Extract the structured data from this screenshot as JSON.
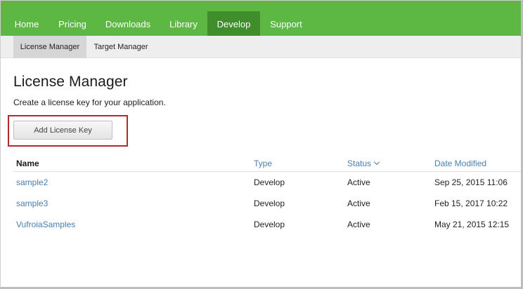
{
  "topnav": {
    "items": [
      {
        "label": "Home"
      },
      {
        "label": "Pricing"
      },
      {
        "label": "Downloads"
      },
      {
        "label": "Library"
      },
      {
        "label": "Develop"
      },
      {
        "label": "Support"
      }
    ],
    "active": "Develop",
    "color": "#5cb843",
    "active_color": "#3f8e2b"
  },
  "subnav": {
    "items": [
      {
        "label": "License Manager"
      },
      {
        "label": "Target Manager"
      }
    ],
    "active": "License Manager"
  },
  "main": {
    "title": "License Manager",
    "description": "Create a license key for your application.",
    "add_button_label": "Add License Key",
    "highlight_color": "#b02a2e"
  },
  "table": {
    "headers": {
      "name": "Name",
      "type": "Type",
      "status": "Status",
      "date": "Date Modified"
    },
    "sort_icon": "chevron-down-icon",
    "rows": [
      {
        "name": "sample2",
        "type": "Develop",
        "status": "Active",
        "date": "Sep 25, 2015 11:06"
      },
      {
        "name": "sample3",
        "type": "Develop",
        "status": "Active",
        "date": "Feb 15, 2017 10:22"
      },
      {
        "name": "VufroiaSamples",
        "type": "Develop",
        "status": "Active",
        "date": "May 21, 2015 12:15"
      }
    ]
  }
}
